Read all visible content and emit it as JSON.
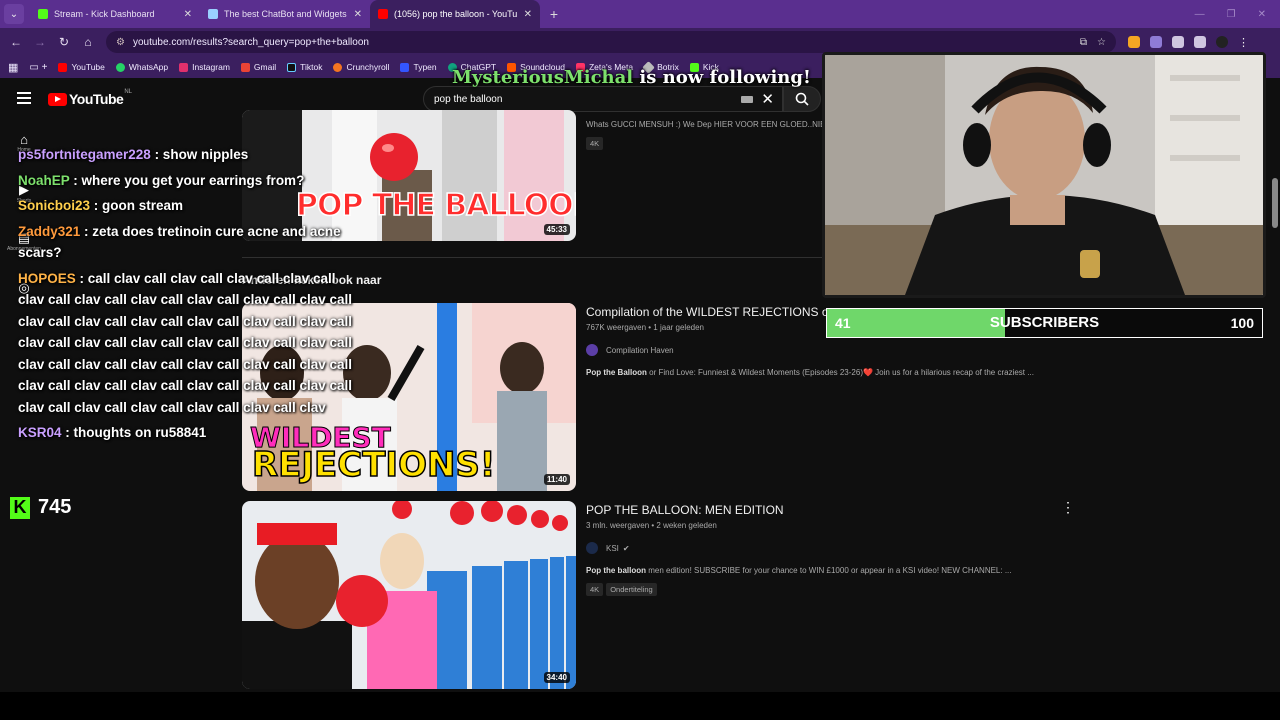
{
  "browser": {
    "tabs": [
      {
        "title": "Stream - Kick Dashboard",
        "color": "#53fc18",
        "active": false
      },
      {
        "title": "The best ChatBot and Widgets",
        "color": "#9ad0ff",
        "active": false
      },
      {
        "title": "(1056) pop the balloon - YouTu",
        "color": "#ff0000",
        "active": true
      }
    ],
    "url": "youtube.com/results?search_query=pop+the+balloon",
    "bookmarks": [
      {
        "label": "YouTube",
        "color": "#ff0000"
      },
      {
        "label": "WhatsApp",
        "color": "#25d366"
      },
      {
        "label": "Instagram",
        "color": "#e1306c"
      },
      {
        "label": "Gmail",
        "color": "#ea4335"
      },
      {
        "label": "Tiktok",
        "color": "#111111"
      },
      {
        "label": "Crunchyroll",
        "color": "#f47521"
      },
      {
        "label": "Typen",
        "color": "#3355ff"
      },
      {
        "label": "ChatGPT",
        "color": "#10a37f"
      },
      {
        "label": "Soundcloud",
        "color": "#ff5500"
      },
      {
        "label": "Zeta's Meta",
        "color": "#ff3366"
      },
      {
        "label": "Botrix",
        "color": "#bbbbbb"
      },
      {
        "label": "Kick",
        "color": "#53fc18"
      }
    ]
  },
  "youtube": {
    "logo_text": "YouTube",
    "region": "NL",
    "search_value": "pop the balloon",
    "rail": [
      {
        "icon": "home-icon",
        "label": "Home"
      },
      {
        "icon": "shorts-icon",
        "label": "Shorts"
      },
      {
        "icon": "subscriptions-icon",
        "label": "Abonnementen"
      },
      {
        "icon": "you-icon",
        "label": "Jij"
      }
    ],
    "video0": {
      "desc": "Whats GUCCI MENSUH :) We Dep HIER VOOR EEN GLOED..NIEUWE",
      "badge": "4K",
      "duration": "45:33",
      "thumb_text": "POP THE BALLOON"
    },
    "section_heading": "Anderen keken ook naar",
    "video1": {
      "title": "Compilation of the WILDEST REJECTIONS on",
      "meta": "767K weergaven • 1 jaar geleden",
      "channel": "Compilation Haven",
      "desc_bold": "Pop the Balloon",
      "desc": " or Find Love: Funniest & Wildest Moments (Episodes 23-26)❤️ Join us for a hilarious recap of the craziest ...",
      "duration": "11:40",
      "thumb_text_1": "WILDEST",
      "thumb_text_2": "REJECTIONS!"
    },
    "video2": {
      "title": "POP THE BALLOON: MEN EDITION",
      "meta": "3 mln. weergaven • 2 weken geleden",
      "channel": "KSI",
      "desc_bold": "Pop the balloon",
      "desc": " men edition! SUBSCRIBE for your chance to WIN £1000 or appear in a KSI video! NEW CHANNEL: ...",
      "badges": [
        "4K",
        "Ondertiteling"
      ],
      "duration": "34:40"
    }
  },
  "overlay": {
    "follow": {
      "name": "MysteriousMichal",
      "text": " is now following!"
    },
    "chat": [
      {
        "user": "ps5fortnitegamer228",
        "user_color": "#c9a0ff",
        "text": " : show nipples"
      },
      {
        "user": "NoahEP",
        "user_color": "#7de06c",
        "text": " : where you get your earrings from?"
      },
      {
        "user": "Sonicboi23",
        "user_color": "#ffcf4d",
        "text": " : goon stream"
      },
      {
        "user": "Zaddy321",
        "user_color": "#ff9a3c",
        "text": " : zeta does tretinoin cure acne and acne scars?"
      },
      {
        "user": "HOPOES",
        "user_color": "#ffb347",
        "text": " : call clav call clav call clav call clav call clav call clav call clav call clav call clav call clav call clav call clav call clav call clav call clav call clav call clav call clav call clav call clav call clav call clav call clav call clav call clav call clav call clav call clav call clav call clav call clav call clav call clav call clav call clav call clav call clav call clav call clav call clav"
      },
      {
        "user": "KSR04",
        "user_color": "#c9a0ff",
        "text": " : thoughts on ru58841"
      }
    ],
    "kick_viewers": "745",
    "sub_goal": {
      "current": "41",
      "label": "SUBSCRIBERS",
      "target": "100",
      "progress": 0.41
    }
  }
}
